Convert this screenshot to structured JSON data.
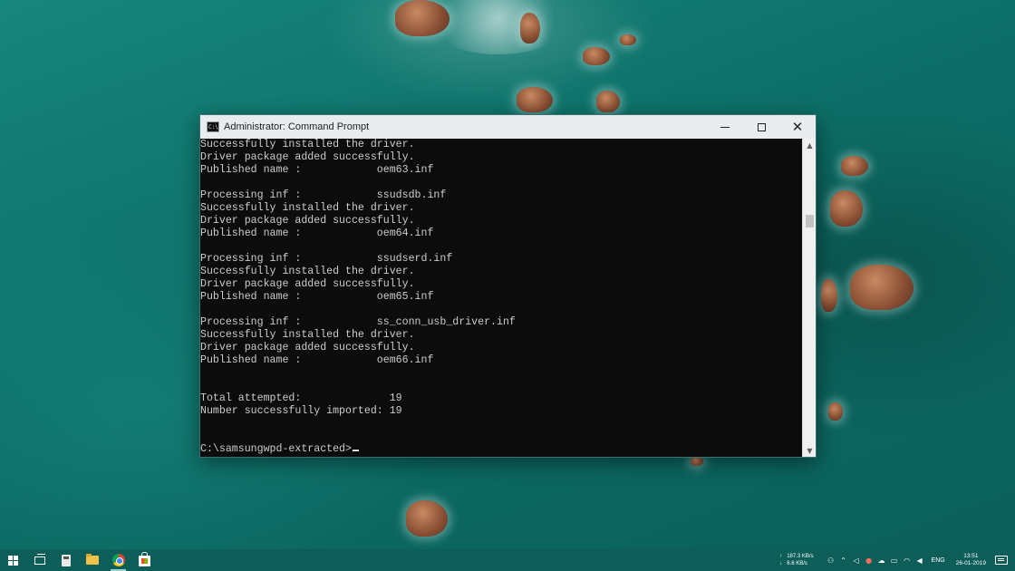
{
  "window": {
    "title": "Administrator: Command Prompt",
    "app_icon_text": "C:\\",
    "controls": {
      "minimize": "minimize",
      "maximize": "maximize",
      "close": "✕"
    }
  },
  "console": {
    "lines": [
      "Successfully installed the driver.",
      "Driver package added successfully.",
      "Published name :            oem63.inf",
      "",
      "Processing inf :            ssudsdb.inf",
      "Successfully installed the driver.",
      "Driver package added successfully.",
      "Published name :            oem64.inf",
      "",
      "Processing inf :            ssudserd.inf",
      "Successfully installed the driver.",
      "Driver package added successfully.",
      "Published name :            oem65.inf",
      "",
      "Processing inf :            ss_conn_usb_driver.inf",
      "Successfully installed the driver.",
      "Driver package added successfully.",
      "Published name :            oem66.inf",
      "",
      "",
      "Total attempted:              19",
      "Number successfully imported: 19",
      "",
      ""
    ],
    "prompt": "C:\\samsungwpd-extracted>"
  },
  "scrollbar": {
    "up_icon": "chevron-up-icon",
    "down_icon": "chevron-down-icon"
  },
  "taskbar": {
    "items": [
      "windows-start-icon",
      "task-view-icon",
      "calculator-icon",
      "file-explorer-icon",
      "chrome-icon",
      "store-icon"
    ],
    "net_upload": "187.3 KB/s",
    "net_download": "6.6 KB/s",
    "language": "ENG",
    "time": "13:51",
    "date": "26-01-2019"
  }
}
